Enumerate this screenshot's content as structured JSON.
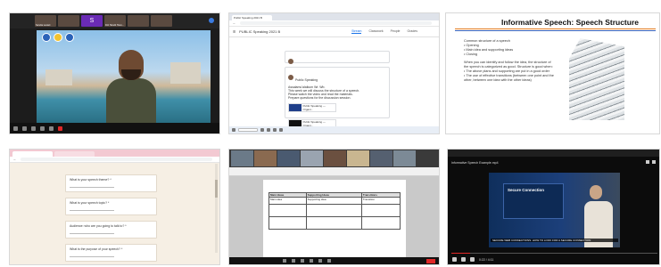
{
  "panel_zoom_call": {
    "participant_tiles": [
      "",
      "",
      "S",
      "",
      "",
      ""
    ],
    "participant_name": "Sandra Lestari",
    "participant_names_2": "Fitri Handri Husn..."
  },
  "panel_classroom": {
    "tab_label": "Public Speaking 2021 B",
    "class_title": "PUBLIC Speaking 2021 B",
    "nav_tabs": [
      "Stream",
      "Classwork",
      "People",
      "Grades"
    ],
    "post1_text": "Class 2021 B - Dear students, please read the attached file before class.",
    "post2_author": "Public Speaking",
    "post2_lines": [
      "Assalamu'alaikum Wr. Wb.",
      "This week we will discuss the structure of a speech.",
      "Please watch the video and read the materials.",
      "Prepare questions for the discussion session."
    ],
    "attachments": [
      {
        "label": "Public Speaking — Organi..."
      },
      {
        "label": "Public Speaking — Organi..."
      }
    ]
  },
  "panel_slide": {
    "title": "Informative Speech: Speech Structure",
    "bullets": [
      "Common structure of a speech",
      "• Opening",
      "• Main idea and supporting ideas",
      "• Closing",
      "",
      "When you can identify and follow the idea, the structure of",
      "the speech is categorized as good. Structure is good when:",
      "• The above plans and supporting are put in a good order",
      "• The use of effective transitions (between one point and the",
      "  other, between one idea with the other ideas)"
    ]
  },
  "panel_form": {
    "questions": [
      "What is your speech theme? *",
      "What is your speech topic? *",
      "Audience: who are you going to talk to? *",
      "What is the purpose of your speech? *"
    ]
  },
  "panel_doc": {
    "table_headers": [
      "Main Ideas",
      "Supporting Ideas",
      "Transitions"
    ],
    "table_rows": [
      [
        "Main idea",
        "Supporting idea",
        "Transition"
      ],
      [
        "",
        "",
        ""
      ],
      [
        "",
        "",
        ""
      ]
    ]
  },
  "panel_video": {
    "video_title": "Informative Speech Example.mp4",
    "screen_text": "Secure Connection",
    "subtitle": "SECURE WEB CONNECTIONS: HOW TO LOOK FOR A SECURE CONNECTION",
    "time": "0:22 / 4:11",
    "progress_fraction": 0.09
  },
  "colors": {
    "accent_orange": "#e07b21",
    "accent_blue": "#3b63b8",
    "zoom_red": "#e02828",
    "classroom_blue": "#1a73e8"
  }
}
